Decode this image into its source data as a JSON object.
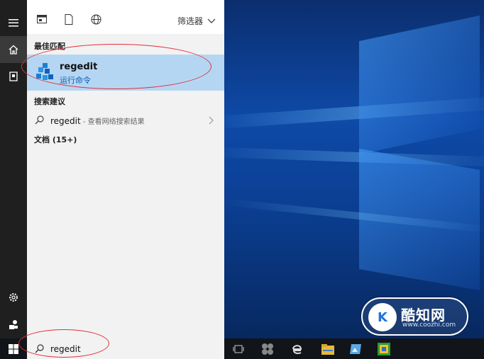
{
  "start_panel": {
    "filter_label": "筛选器",
    "best_match": {
      "heading": "最佳匹配",
      "title": "regedit",
      "subtitle": "运行命令"
    },
    "suggestions": {
      "heading": "搜索建议",
      "query": "regedit",
      "hint": " - 查看网络搜索结果"
    },
    "documents": {
      "heading": "文档 (15+)"
    }
  },
  "taskbar": {
    "search_value": "regedit"
  },
  "watermark": {
    "name": "酷知网",
    "url": "www.coozhi.com",
    "logo_letters": "K"
  },
  "icons": {
    "rail": [
      "hamburger-icon",
      "home-icon",
      "tablet-icon",
      "settings-icon",
      "user-icon"
    ],
    "panel_top": [
      "apps-icon",
      "documents-icon",
      "web-icon"
    ],
    "taskbar": [
      "windows-start-icon",
      "search-icon",
      "task-view-icon",
      "store-icon",
      "edge-icon",
      "file-explorer-icon",
      "photos-icon",
      "app-icon"
    ]
  },
  "colors": {
    "highlight": "#b5d6f3",
    "accent_text": "#0b5db5",
    "annotation_ellipse": "#e0313b"
  }
}
